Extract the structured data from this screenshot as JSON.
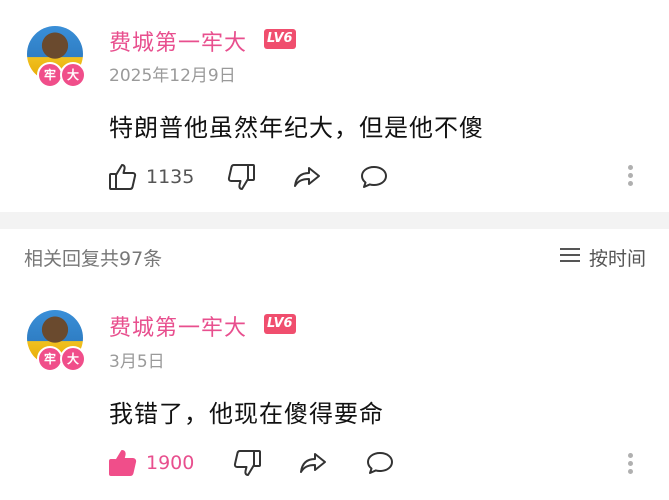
{
  "main_comment": {
    "username": "费城第一牢大",
    "level": "LV6",
    "avatar_badge": [
      "牢",
      "大"
    ],
    "date": "2025年12月9日",
    "text": "特朗普他虽然年纪大，但是他不傻",
    "like_count": "1135"
  },
  "replies_header": {
    "count_label": "相关回复共97条",
    "sort_label": "按时间"
  },
  "reply": {
    "username": "费城第一牢大",
    "level": "LV6",
    "avatar_badge": [
      "牢",
      "大"
    ],
    "date": "3月5日",
    "text": "我错了，他现在傻得要命",
    "like_count": "1900",
    "liked": true
  },
  "colors": {
    "accent_pink": "#e84f8e",
    "level_badge": "#f04e6e",
    "muted_text": "#9a9a9a",
    "divider": "#f3f3f3"
  },
  "icons": [
    "thumbs-up-icon",
    "thumbs-down-icon",
    "share-icon",
    "comment-bubble-icon",
    "more-vertical-icon",
    "sort-lines-icon"
  ]
}
